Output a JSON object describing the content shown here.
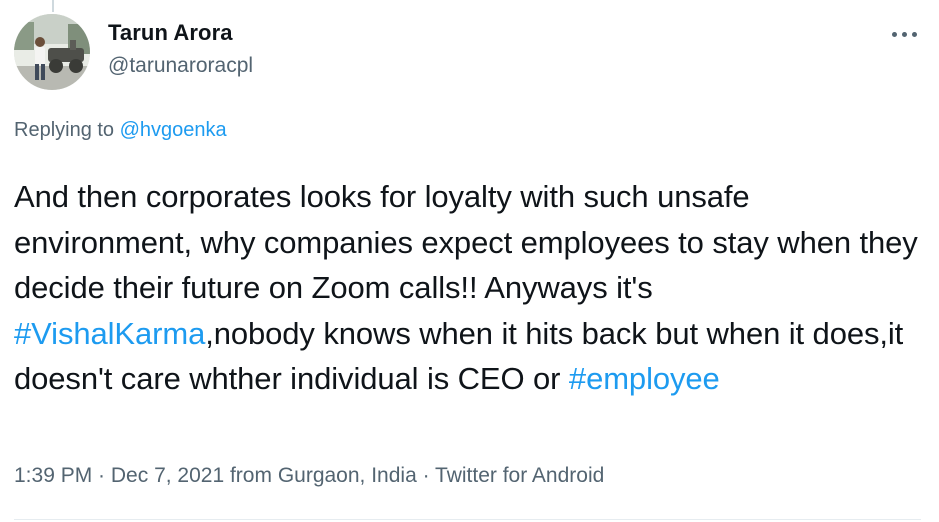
{
  "author": {
    "display_name": "Tarun Arora",
    "handle": "@tarunaroracpl",
    "avatar_icon": "profile-photo"
  },
  "more_menu": {
    "icon": "more-horizontal-icon"
  },
  "reply_context": {
    "prefix": "Replying to",
    "mention": "@hvgoenka"
  },
  "tweet": {
    "text_part1": "And then corporates looks for loyalty with such unsafe environment, why companies expect employees to stay when they decide their future on Zoom calls!! Anyways it's ",
    "hashtag1": "#VishalKarma",
    "text_part2": ",nobody knows when it hits back but when it does,it doesn't care whther individual is CEO or ",
    "hashtag2": "#employee"
  },
  "metadata": {
    "time": "1:39 PM",
    "separator1": " · ",
    "date": "Dec 7, 2021",
    "from_prefix": " from ",
    "location": "Gurgaon, India",
    "separator2": " · ",
    "source": "Twitter for Android"
  },
  "colors": {
    "link": "#1d9bf0",
    "secondary_text": "#536471",
    "primary_text": "#0f1419"
  }
}
